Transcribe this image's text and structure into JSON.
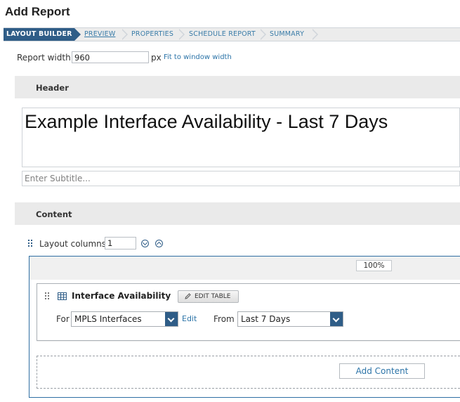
{
  "page": {
    "title": "Add Report"
  },
  "wizard": {
    "steps": [
      {
        "label": "LAYOUT BUILDER"
      },
      {
        "label": "PREVIEW"
      },
      {
        "label": "PROPERTIES"
      },
      {
        "label": "SCHEDULE REPORT"
      },
      {
        "label": "SUMMARY"
      }
    ]
  },
  "report_width": {
    "label": "Report width",
    "value": "960",
    "unit": "px",
    "fit_link": "Fit to window width"
  },
  "header_section": {
    "label": "Header",
    "title_text": "Example Interface Availability - Last 7 Days",
    "subtitle_placeholder": "Enter Subtitle..."
  },
  "content_section": {
    "label": "Content",
    "layout_columns_label": "Layout columns",
    "layout_columns_value": "1",
    "column_width": "100%"
  },
  "resource": {
    "title": "Interface Availability",
    "edit_table_label": "EDIT TABLE",
    "for_label": "For",
    "for_value": "MPLS Interfaces",
    "edit_link": "Edit",
    "from_label": "From",
    "from_value": "Last 7 Days"
  },
  "add_content_label": "Add Content",
  "colors": {
    "accent": "#2f5d87",
    "link": "#2c74a8"
  }
}
